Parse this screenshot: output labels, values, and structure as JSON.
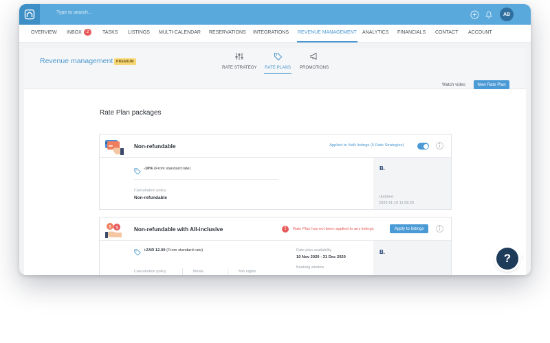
{
  "topbar": {
    "search_placeholder": "Type to search...",
    "avatar_initials": "AB"
  },
  "nav": {
    "items": [
      {
        "label": "OVERVIEW"
      },
      {
        "label": "INBOX",
        "badge": "2"
      },
      {
        "label": "TASKS"
      },
      {
        "label": "LISTINGS"
      },
      {
        "label": "MULTI-CALENDAR"
      },
      {
        "label": "RESERVATIONS"
      },
      {
        "label": "INTEGRATIONS"
      },
      {
        "label": "REVENUE MANAGEMENT",
        "active": true
      },
      {
        "label": "ANALYTICS"
      },
      {
        "label": "FINANCIALS"
      },
      {
        "label": "CONTACT"
      },
      {
        "label": "ACCOUNT"
      }
    ]
  },
  "page": {
    "title": "Revenue management",
    "premium_badge": "PREMIUM",
    "tabs": [
      {
        "label": "RATE STRATEGY",
        "icon": "sliders-icon"
      },
      {
        "label": "RATE PLANS",
        "icon": "tag-icon",
        "active": true
      },
      {
        "label": "PROMOTIONS",
        "icon": "megaphone-icon"
      }
    ],
    "watch_video": "Watch video",
    "new_rate_plan": "New Rate Plan",
    "section_title": "Rate Plan packages"
  },
  "plans": [
    {
      "name": "Non-refundable",
      "applied_text": "Applied to NaN listings (5 Rate Strategies)",
      "discount": "-10%",
      "discount_suffix": "(From standard rate)",
      "cancellation_label": "Cancellation policy",
      "cancellation_value": "Non-refundable",
      "brand_letter": "B.",
      "updated_label": "Updated",
      "updated_value": "2020-11-10 11:58:29"
    },
    {
      "name": "Non-refundable with All-inclusive",
      "warning_text": "Rate Plan has not been applied to any listings",
      "apply_button": "Apply to listings",
      "price": "+ZAR 12.00",
      "price_suffix": "(From standard rate)",
      "availability_label": "Rate plan availability",
      "availability_value": "10 Nov 2020 - 31 Dec 2020",
      "booking_window_label": "Booking window",
      "cancellation_label": "Cancellation policy",
      "meals_label": "Meals",
      "min_nights_label": "Min nights",
      "brand_letter": "B."
    }
  ],
  "help_button": "?",
  "colors": {
    "brand": "#5aa9dc",
    "accent": "#4a97cf",
    "warning": "#e85a5a",
    "premium": "#f7d774"
  }
}
